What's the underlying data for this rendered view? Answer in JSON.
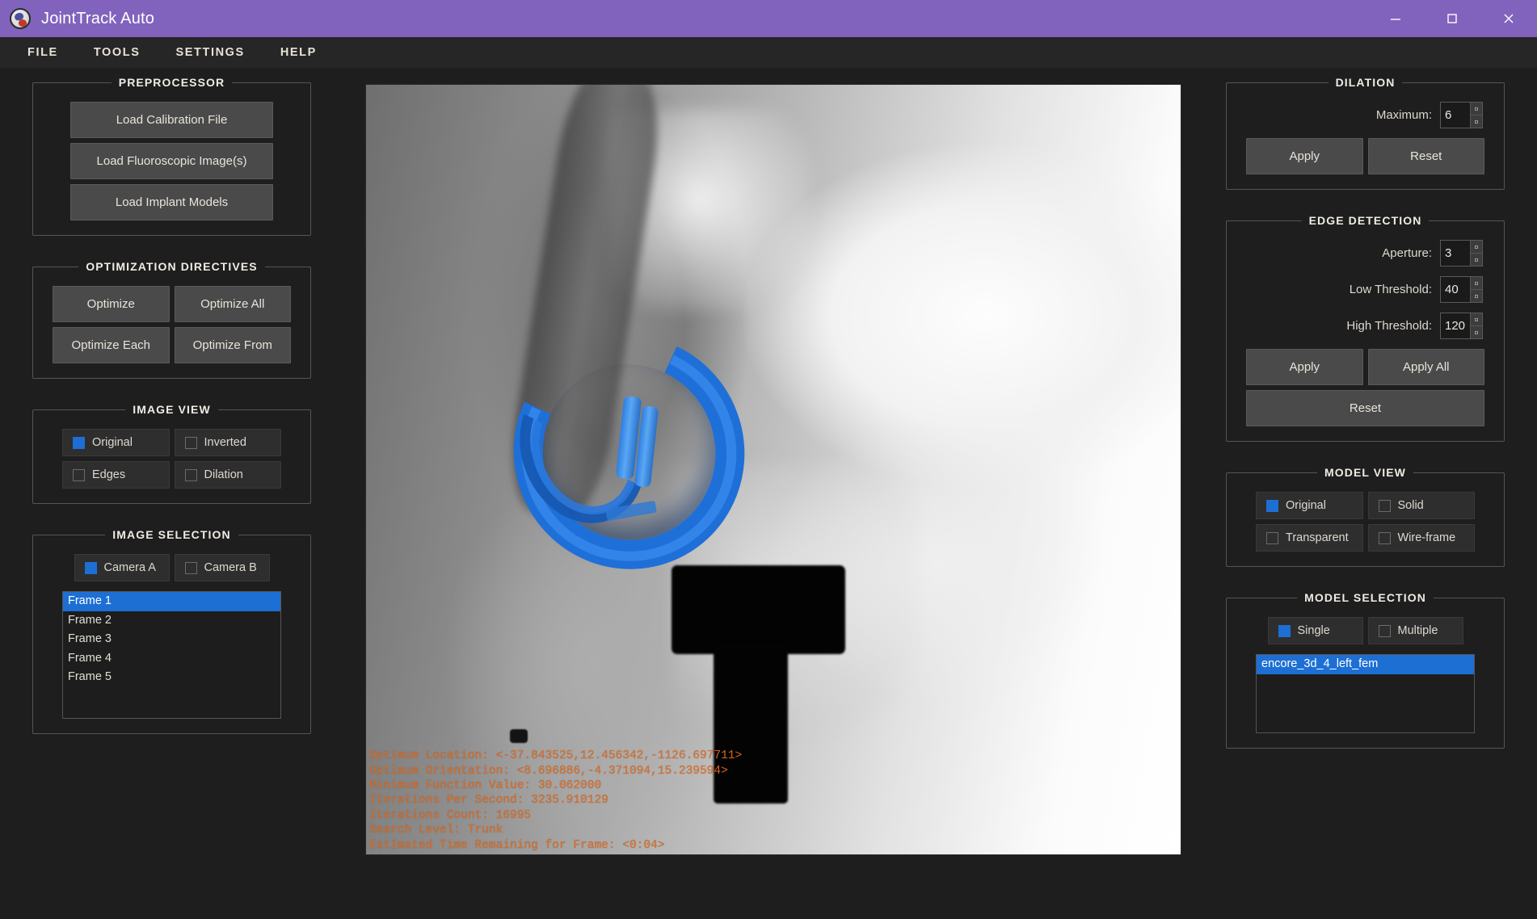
{
  "window": {
    "title": "JointTrack Auto",
    "icon": "app-logo-icon",
    "minimize_label": "–",
    "maximize_label": "□",
    "close_label": "✕"
  },
  "menubar": {
    "items": [
      {
        "label": "FILE"
      },
      {
        "label": "TOOLS"
      },
      {
        "label": "SETTINGS"
      },
      {
        "label": "HELP"
      }
    ]
  },
  "left": {
    "preprocessor": {
      "title": "PREPROCESSOR",
      "buttons": [
        {
          "label": "Load Calibration File"
        },
        {
          "label": "Load Fluoroscopic Image(s)"
        },
        {
          "label": "Load Implant Models"
        }
      ]
    },
    "optimization": {
      "title": "OPTIMIZATION DIRECTIVES",
      "buttons": [
        {
          "label": "Optimize"
        },
        {
          "label": "Optimize All"
        },
        {
          "label": "Optimize Each"
        },
        {
          "label": "Optimize From"
        }
      ]
    },
    "image_view": {
      "title": "IMAGE VIEW",
      "options": [
        {
          "label": "Original",
          "checked": true
        },
        {
          "label": "Inverted",
          "checked": false
        },
        {
          "label": "Edges",
          "checked": false
        },
        {
          "label": "Dilation",
          "checked": false
        }
      ]
    },
    "image_selection": {
      "title": "IMAGE SELECTION",
      "cameras": [
        {
          "label": "Camera A",
          "checked": true
        },
        {
          "label": "Camera B",
          "checked": false
        }
      ],
      "frames": [
        {
          "label": "Frame 1",
          "selected": true
        },
        {
          "label": "Frame 2",
          "selected": false
        },
        {
          "label": "Frame 3",
          "selected": false
        },
        {
          "label": "Frame 4",
          "selected": false
        },
        {
          "label": "Frame 5",
          "selected": false
        }
      ]
    }
  },
  "right": {
    "dilation": {
      "title": "DILATION",
      "maximum_label": "Maximum:",
      "maximum_value": "6",
      "apply_label": "Apply",
      "reset_label": "Reset"
    },
    "edge_detection": {
      "title": "EDGE DETECTION",
      "aperture_label": "Aperture:",
      "aperture_value": "3",
      "low_threshold_label": "Low Threshold:",
      "low_threshold_value": "40",
      "high_threshold_label": "High Threshold:",
      "high_threshold_value": "120",
      "apply_label": "Apply",
      "apply_all_label": "Apply All",
      "reset_label": "Reset"
    },
    "model_view": {
      "title": "MODEL VIEW",
      "options": [
        {
          "label": "Original",
          "checked": true
        },
        {
          "label": "Solid",
          "checked": false
        },
        {
          "label": "Transparent",
          "checked": false
        },
        {
          "label": "Wire-frame",
          "checked": false
        }
      ]
    },
    "model_selection": {
      "title": "MODEL SELECTION",
      "modes": [
        {
          "label": "Single",
          "checked": true
        },
        {
          "label": "Multiple",
          "checked": false
        }
      ],
      "models": [
        {
          "label": "encore_3d_4_left_fem",
          "selected": true
        }
      ]
    }
  },
  "viewport": {
    "overlay": {
      "lines": [
        "Optimum Location: <-37.843525,12.456342,-1126.697711>",
        "Optimum Orientation: <8.696886,-4.371094,15.239594>",
        "Minimum Function Value: 30.062000",
        "Iterations Per Second: 3235.910129",
        "Iterations Count: 16995",
        "Search Level: Trunk",
        "Estimated Time Remaining for Frame: <0:04>"
      ],
      "text": "Optimum Location: <-37.843525,12.456342,-1126.697711>\nOptimum Orientation: <8.696886,-4.371094,15.239594>\nMinimum Function Value: 30.062000\nIterations Per Second: 3235.910129\nIterations Count: 16995\nSearch Level: Trunk\nEstimated Time Remaining for Frame: <0:04>"
    }
  },
  "colors": {
    "titlebar": "#8163bd",
    "menubar": "#262626",
    "background": "#1e1e1e",
    "accent_blue": "#1d6fd4",
    "overlay_orange": "#e36c1f",
    "button": "#4a4a4a"
  }
}
